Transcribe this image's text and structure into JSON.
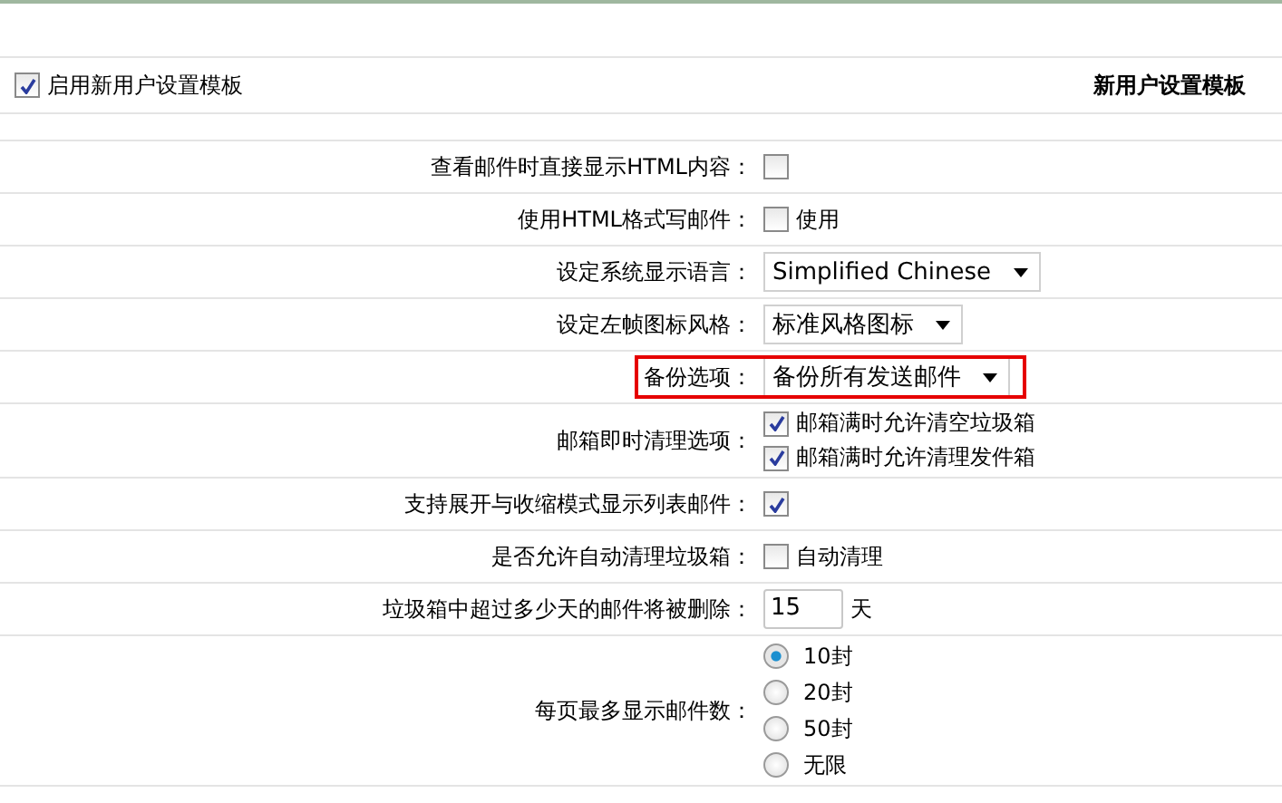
{
  "header": {
    "enable_label": "启用新用户设置模板",
    "enabled": true,
    "title": "新用户设置模板"
  },
  "rows": [
    {
      "kind": "checkbox",
      "label": "查看邮件时直接显示HTML内容：",
      "options": [
        {
          "checked": false
        }
      ]
    },
    {
      "kind": "checkbox",
      "label": "使用HTML格式写邮件：",
      "options": [
        {
          "text": "使用",
          "checked": false
        }
      ]
    },
    {
      "kind": "select",
      "label": "设定系统显示语言：",
      "value": "Simplified Chinese"
    },
    {
      "kind": "select",
      "label": "设定左帧图标风格：",
      "value": "标准风格图标"
    },
    {
      "kind": "select",
      "label": "备份选项：",
      "value": "备份所有发送邮件",
      "highlighted": true
    },
    {
      "kind": "checkbox",
      "label": "邮箱即时清理选项：",
      "options": [
        {
          "text": "邮箱满时允许清空垃圾箱",
          "checked": true
        },
        {
          "text": "邮箱满时允许清理发件箱",
          "checked": true
        }
      ]
    },
    {
      "kind": "checkbox",
      "label": "支持展开与收缩模式显示列表邮件：",
      "options": [
        {
          "checked": true
        }
      ]
    },
    {
      "kind": "checkbox",
      "label": "是否允许自动清理垃圾箱：",
      "options": [
        {
          "text": "自动清理",
          "checked": false
        }
      ]
    },
    {
      "kind": "input",
      "label": "垃圾箱中超过多少天的邮件将被删除：",
      "value": "15",
      "suffix": "天"
    },
    {
      "kind": "radio",
      "label": "每页最多显示邮件数：",
      "options": [
        {
          "text": "10封",
          "selected": true
        },
        {
          "text": "20封",
          "selected": false
        },
        {
          "text": "50封",
          "selected": false
        },
        {
          "text": "无限",
          "selected": false
        }
      ]
    }
  ]
}
